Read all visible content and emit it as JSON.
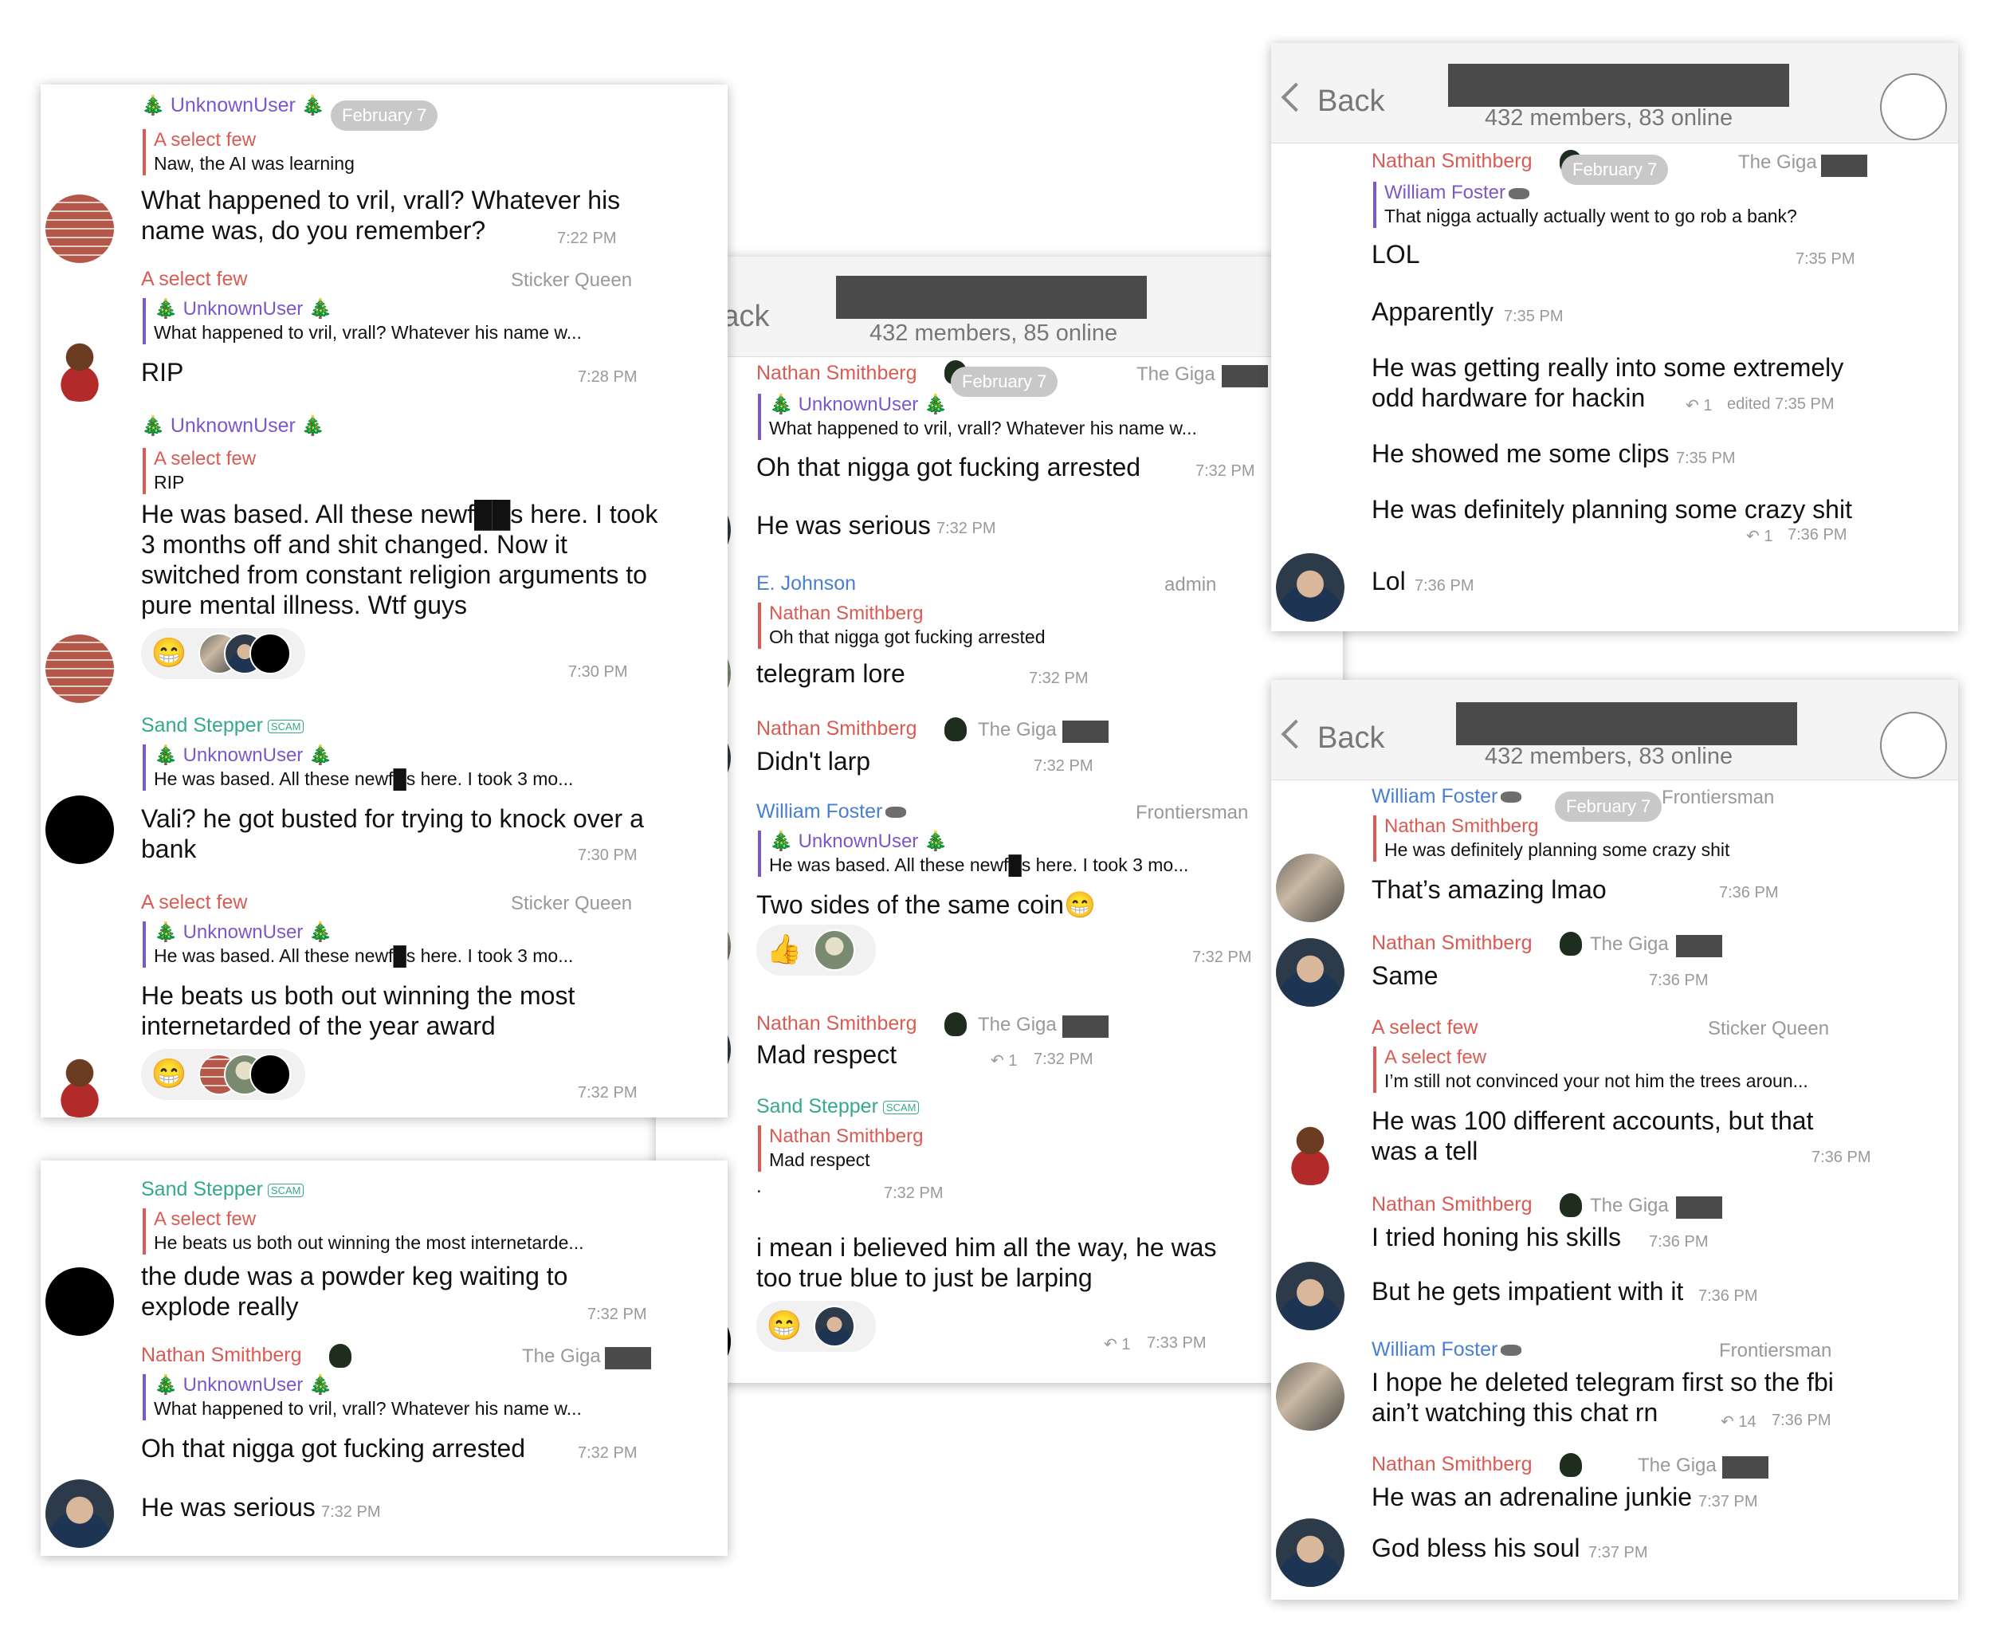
{
  "common": {
    "date": "February 7",
    "members_85": "432 members, 85 online",
    "members_83": "432 members, 83 online",
    "back": "Back",
    "scam": "SCAM",
    "tree": "🎄"
  },
  "users": {
    "unknown": "UnknownUser",
    "select_few": "A select few",
    "sand": "Sand Stepper",
    "nathan": "Nathan Smithberg",
    "ejohnson": "E. Johnson",
    "william": "William Foster"
  },
  "roles": {
    "sticker_queen": "Sticker Queen",
    "giga": "The Giga",
    "admin": "admin",
    "frontiersman": "Frontiersman"
  },
  "panel1": {
    "m1": {
      "quote": "Naw, the AI was learning",
      "text": "What happened to vril, vrall? Whatever his name was, do you remember?",
      "time": "7:22 PM"
    },
    "m2": {
      "quote": "What happened to vril, vrall? Whatever his name w...",
      "text": "RIP",
      "time": "7:28 PM"
    },
    "m3": {
      "quote": "RIP",
      "text": "He was based. All these newf██s here. I took 3 months off and shit changed. Now it switched from constant religion arguments to pure mental illness. Wtf guys",
      "time": "7:30 PM"
    },
    "m4": {
      "quote": "He was based. All these newf█s here. I took 3 mo...",
      "text": "Vali? he got busted for trying to knock over a bank",
      "time": "7:30 PM"
    },
    "m5": {
      "quote": "He was based. All these newf█s here. I took 3 mo...",
      "text": "He beats us both out winning the most internetarded of the year award",
      "time": "7:32 PM"
    },
    "emoji": "😁"
  },
  "panel2": {
    "m1": {
      "quote": "He beats us both out winning the most internetarde...",
      "text": "the dude was a powder keg waiting to explode really",
      "time": "7:32 PM"
    },
    "m2": {
      "quote": "What happened to vril, vrall? Whatever his name w...",
      "text": "Oh that nigga got fucking arrested",
      "time": "7:32 PM"
    },
    "m3": {
      "text": "He was serious",
      "time": "7:32 PM"
    }
  },
  "panel3": {
    "m1": {
      "quote": "What happened to vril, vrall? Whatever his name w...",
      "text": "Oh that nigga got fucking arrested",
      "time": "7:32 PM"
    },
    "m2": {
      "text": "He was serious",
      "time": "7:32 PM"
    },
    "m3": {
      "quote": "Oh that nigga got fucking arrested",
      "text": "telegram lore",
      "time": "7:32 PM"
    },
    "m4": {
      "text": "Didn't larp",
      "time": "7:32 PM"
    },
    "m5": {
      "quote": "He was based. All these newf█s here. I took 3 mo...",
      "text": "Two sides of the same coin😁",
      "time": "7:32 PM",
      "reaction": "👍"
    },
    "m6": {
      "text": "Mad respect",
      "time": "7:32 PM",
      "reply_count": "1"
    },
    "m7": {
      "quote": "Mad respect",
      "text": ".",
      "time": "7:32 PM"
    },
    "m8": {
      "text": "i mean i believed him all the way, he was too true blue to just be larping",
      "time": "7:33 PM",
      "reply_count": "1",
      "reaction": "😁"
    }
  },
  "panel4": {
    "m1": {
      "quote": "That nigga actually actually went to go rob a bank?",
      "text": "LOL",
      "time": "7:35 PM"
    },
    "m2": {
      "text": "Apparently",
      "time": "7:35 PM"
    },
    "m3": {
      "text": "He was getting really into some extremely odd hardware for hackin",
      "time": "edited 7:35 PM",
      "reply_count": "1"
    },
    "m4": {
      "text": "He showed me some clips",
      "time": "7:35 PM"
    },
    "m5": {
      "text": "He was definitely planning some crazy shit",
      "time": "7:36 PM",
      "reply_count": "1"
    },
    "m6": {
      "text": "Lol",
      "time": "7:36 PM"
    }
  },
  "panel5": {
    "m1": {
      "quote": "He was definitely planning some crazy shit",
      "text": "That’s amazing lmao",
      "time": "7:36 PM"
    },
    "m2": {
      "text": "Same",
      "time": "7:36 PM"
    },
    "m3": {
      "quote": "I’m still not convinced your not him the trees aroun...",
      "text": "He was 100 different accounts, but that was a tell",
      "time": "7:36 PM"
    },
    "m4": {
      "text": "I tried honing his skills",
      "time": "7:36 PM"
    },
    "m5": {
      "text": "But he gets impatient with it",
      "time": "7:36 PM"
    },
    "m6": {
      "text": "I hope he deleted telegram first so the fbi ain’t watching this chat rn",
      "time": "7:36 PM",
      "reply_count": "14"
    },
    "m7": {
      "text": "He was an adrenaline junkie",
      "time": "7:37 PM"
    },
    "m8": {
      "text": "God bless his soul",
      "time": "7:37 PM"
    }
  }
}
